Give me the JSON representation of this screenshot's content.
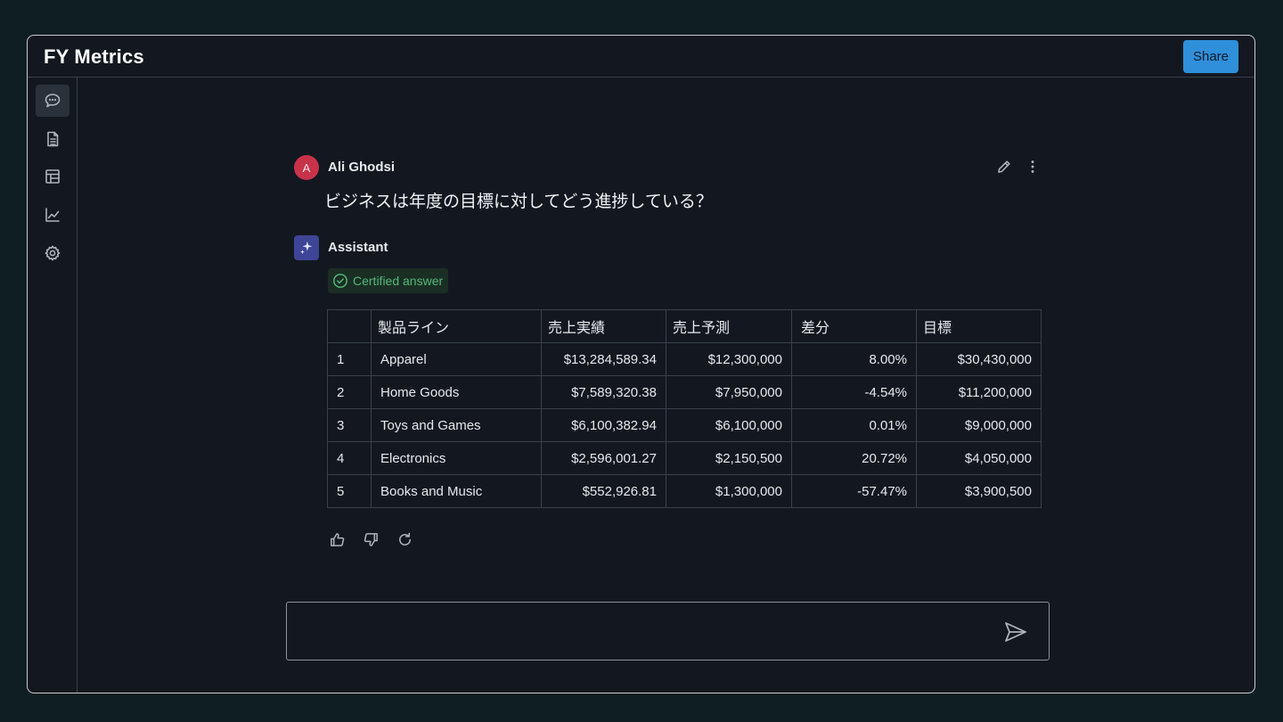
{
  "app": {
    "title": "FY Metrics",
    "share_label": "Share"
  },
  "sidebar": {
    "items": [
      {
        "name": "chat",
        "icon": "chat-bubble-icon",
        "active": true
      },
      {
        "name": "documents",
        "icon": "document-icon",
        "active": false
      },
      {
        "name": "tables",
        "icon": "table-icon",
        "active": false
      },
      {
        "name": "charts",
        "icon": "line-chart-icon",
        "active": false
      },
      {
        "name": "settings",
        "icon": "gear-icon",
        "active": false
      }
    ]
  },
  "conversation": {
    "user": {
      "avatar_initial": "A",
      "name": "Ali Ghodsi",
      "question": "ビジネスは年度の目標に対してどう進捗している？"
    },
    "assistant": {
      "name": "Assistant",
      "badge": "Certified answer",
      "table": {
        "columns": [
          "",
          "製品ライン",
          "売上実績",
          "売上予測",
          "差分",
          "目標"
        ],
        "rows": [
          [
            "1",
            "Apparel",
            "$13,284,589.34",
            "$12,300,000",
            "8.00%",
            "$30,430,000"
          ],
          [
            "2",
            "Home Goods",
            "$7,589,320.38",
            "$7,950,000",
            "-4.54%",
            "$11,200,000"
          ],
          [
            "3",
            "Toys and Games",
            "$6,100,382.94",
            "$6,100,000",
            "0.01%",
            "$9,000,000"
          ],
          [
            "4",
            "Electronics",
            "$2,596,001.27",
            "$2,150,500",
            "20.72%",
            "$4,050,000"
          ],
          [
            "5",
            "Books and Music",
            "$552,926.81",
            "$1,300,000",
            "-57.47%",
            "$3,900,500"
          ]
        ]
      }
    }
  },
  "composer": {
    "value": "",
    "placeholder": ""
  },
  "colors": {
    "accent": "#2f8fdb",
    "user_avatar": "#c8334a",
    "assistant_avatar": "#3e4596",
    "certified": "#54b97a"
  }
}
